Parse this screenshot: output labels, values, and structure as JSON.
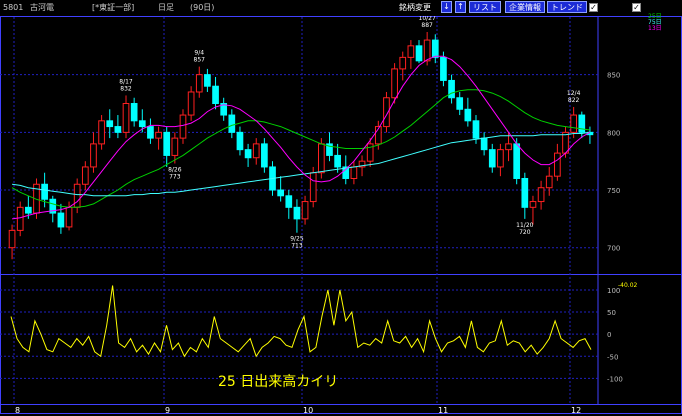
{
  "toolbar": {
    "code": "5801",
    "name": "古河電",
    "market": "[*東証一部]",
    "period": "日足",
    "span": "(90日)",
    "change_stock_label": "銘柄変更",
    "down_arrow": "↓",
    "up_arrow": "↑",
    "list_label": "リスト",
    "company_info_label": "企業情報",
    "trend_label": "トレンド",
    "check1_label": "",
    "check2_label": "",
    "ma_legend": [
      "25日",
      "75日",
      "13日"
    ]
  },
  "colors": {
    "background": "#000000",
    "up_candle": "#ff2020",
    "down_candle": "#00ffff",
    "ma_short": "#ff00ff",
    "ma_mid": "#00d000",
    "ma_long": "#40ffff",
    "kairi": "#ffff00",
    "grid": "#0000ff",
    "axis_text": "#ffffff"
  },
  "chart_data": [
    {
      "type": "candlestick",
      "title": "",
      "price_ticks": [
        700,
        750,
        800,
        850
      ],
      "ylim": [
        685,
        900
      ],
      "x_month_labels": [
        "8",
        "9",
        "10",
        "11",
        "12"
      ],
      "grid": true,
      "annotations": [
        {
          "label_date": "8/17",
          "label_value": "832",
          "kind": "high"
        },
        {
          "label_date": "9/4",
          "label_value": "857",
          "kind": "high"
        },
        {
          "label_date": "8/26",
          "label_value": "773",
          "kind": "low"
        },
        {
          "label_date": "9/25",
          "label_value": "713",
          "kind": "low"
        },
        {
          "label_date": "10/27",
          "label_value": "887",
          "kind": "high"
        },
        {
          "label_date": "11/20",
          "label_value": "720",
          "kind": "low"
        },
        {
          "label_date": "12/4",
          "label_value": "822",
          "kind": "high"
        }
      ],
      "candles": [
        [
          700,
          720,
          690,
          715
        ],
        [
          715,
          740,
          710,
          735
        ],
        [
          735,
          745,
          725,
          730
        ],
        [
          730,
          760,
          725,
          755
        ],
        [
          755,
          765,
          735,
          742
        ],
        [
          742,
          745,
          722,
          730
        ],
        [
          730,
          738,
          712,
          718
        ],
        [
          718,
          740,
          715,
          735
        ],
        [
          735,
          760,
          730,
          755
        ],
        [
          755,
          775,
          750,
          770
        ],
        [
          770,
          800,
          765,
          790
        ],
        [
          790,
          815,
          785,
          810
        ],
        [
          810,
          820,
          795,
          805
        ],
        [
          805,
          815,
          795,
          800
        ],
        [
          800,
          832,
          795,
          825
        ],
        [
          825,
          830,
          805,
          810
        ],
        [
          810,
          820,
          800,
          805
        ],
        [
          805,
          812,
          790,
          795
        ],
        [
          795,
          805,
          785,
          800
        ],
        [
          800,
          805,
          770,
          780
        ],
        [
          780,
          800,
          773,
          795
        ],
        [
          795,
          820,
          790,
          815
        ],
        [
          815,
          840,
          810,
          835
        ],
        [
          835,
          857,
          830,
          850
        ],
        [
          850,
          855,
          835,
          840
        ],
        [
          840,
          848,
          820,
          825
        ],
        [
          825,
          830,
          810,
          815
        ],
        [
          815,
          820,
          795,
          800
        ],
        [
          800,
          805,
          780,
          785
        ],
        [
          785,
          790,
          770,
          778
        ],
        [
          778,
          795,
          772,
          790
        ],
        [
          790,
          795,
          765,
          770
        ],
        [
          770,
          775,
          745,
          750
        ],
        [
          750,
          762,
          740,
          745
        ],
        [
          745,
          750,
          725,
          735
        ],
        [
          735,
          742,
          713,
          725
        ],
        [
          725,
          745,
          720,
          740
        ],
        [
          740,
          770,
          735,
          765
        ],
        [
          765,
          795,
          760,
          790
        ],
        [
          790,
          800,
          775,
          780
        ],
        [
          780,
          790,
          765,
          770
        ],
        [
          770,
          780,
          755,
          760
        ],
        [
          760,
          775,
          755,
          770
        ],
        [
          770,
          780,
          762,
          775
        ],
        [
          775,
          795,
          770,
          790
        ],
        [
          790,
          810,
          785,
          805
        ],
        [
          805,
          835,
          800,
          830
        ],
        [
          830,
          860,
          825,
          855
        ],
        [
          855,
          870,
          845,
          865
        ],
        [
          865,
          880,
          855,
          875
        ],
        [
          875,
          880,
          860,
          862
        ],
        [
          862,
          887,
          858,
          880
        ],
        [
          880,
          885,
          860,
          865
        ],
        [
          865,
          870,
          840,
          845
        ],
        [
          845,
          850,
          825,
          830
        ],
        [
          830,
          835,
          815,
          820
        ],
        [
          820,
          830,
          805,
          810
        ],
        [
          810,
          815,
          790,
          795
        ],
        [
          795,
          800,
          780,
          785
        ],
        [
          785,
          790,
          765,
          770
        ],
        [
          770,
          790,
          762,
          785
        ],
        [
          785,
          800,
          775,
          790
        ],
        [
          790,
          795,
          755,
          760
        ],
        [
          760,
          765,
          725,
          735
        ],
        [
          735,
          745,
          720,
          740
        ],
        [
          740,
          758,
          733,
          752
        ],
        [
          752,
          770,
          745,
          762
        ],
        [
          762,
          790,
          758,
          782
        ],
        [
          782,
          805,
          778,
          800
        ],
        [
          800,
          822,
          795,
          815
        ],
        [
          815,
          818,
          795,
          800
        ],
        [
          800,
          805,
          790,
          798
        ]
      ],
      "series": [
        {
          "name": "25日",
          "values": [
            752,
            748,
            745,
            742,
            740,
            738,
            736,
            735,
            735,
            736,
            738,
            742,
            746,
            750,
            755,
            759,
            762,
            765,
            768,
            772,
            776,
            780,
            785,
            790,
            795,
            799,
            803,
            806,
            808,
            810,
            810,
            809,
            807,
            805,
            802,
            799,
            796,
            793,
            790,
            788,
            787,
            786,
            786,
            786,
            787,
            789,
            792,
            796,
            801,
            806,
            812,
            818,
            824,
            830,
            834,
            836,
            837,
            837,
            836,
            834,
            831,
            827,
            822,
            817,
            813,
            810,
            808,
            806,
            805,
            804,
            803,
            802
          ]
        },
        {
          "name": "75日",
          "values": [
            755,
            754,
            752,
            751,
            750,
            749,
            748,
            747,
            746,
            746,
            745,
            745,
            745,
            745,
            745,
            746,
            746,
            747,
            747,
            748,
            748,
            749,
            750,
            751,
            752,
            753,
            754,
            755,
            756,
            757,
            758,
            759,
            760,
            761,
            762,
            763,
            764,
            765,
            766,
            767,
            768,
            769,
            770,
            771,
            772,
            773,
            775,
            777,
            779,
            781,
            783,
            785,
            787,
            789,
            791,
            792,
            793,
            794,
            795,
            796,
            797,
            797,
            797,
            797,
            797,
            798,
            798,
            798,
            798,
            799,
            799,
            800
          ]
        },
        {
          "name": "13日",
          "values": [
            725,
            726,
            728,
            730,
            731,
            732,
            733,
            735,
            740,
            748,
            757,
            766,
            775,
            784,
            792,
            798,
            803,
            806,
            806,
            805,
            805,
            806,
            808,
            812,
            818,
            822,
            824,
            823,
            820,
            815,
            810,
            803,
            795,
            787,
            778,
            770,
            763,
            758,
            757,
            758,
            762,
            768,
            775,
            784,
            793,
            803,
            815,
            828,
            840,
            850,
            858,
            863,
            866,
            866,
            863,
            857,
            849,
            840,
            830,
            820,
            810,
            800,
            790,
            782,
            776,
            772,
            772,
            776,
            782,
            790,
            796,
            800
          ]
        }
      ]
    },
    {
      "type": "line",
      "title": "25 日出来高カイリ",
      "y_ticks": [
        100,
        50,
        0,
        -50,
        -100
      ],
      "ylim": [
        -115,
        118
      ],
      "current_value_label": "-40.02",
      "series": [
        {
          "name": "",
          "values": [
            40,
            -10,
            -30,
            -40,
            30,
            0,
            -35,
            -40,
            -10,
            -20,
            -30,
            -10,
            -25,
            -5,
            -40,
            -50,
            20,
            110,
            -20,
            -30,
            -10,
            -40,
            -25,
            -45,
            -20,
            -40,
            20,
            -35,
            -20,
            -50,
            -30,
            -40,
            -10,
            -30,
            40,
            -10,
            -20,
            -30,
            -40,
            -25,
            -10,
            -50,
            -30,
            -20,
            -5,
            -10,
            -25,
            -30,
            10,
            40,
            -40,
            -30,
            40,
            100,
            20,
            100,
            30,
            50,
            -30,
            -20,
            -25,
            -10,
            -20,
            30,
            -15,
            -20,
            -5,
            -30,
            -10,
            -40,
            30,
            -10,
            -40,
            -20,
            -15,
            -5,
            -30,
            30,
            -30,
            -40,
            -20,
            -15,
            30,
            -25,
            -15,
            -20,
            -40,
            -25,
            -45,
            -30,
            -10,
            30,
            -10,
            -20,
            -30,
            -15,
            -10,
            -35
          ]
        }
      ]
    }
  ]
}
